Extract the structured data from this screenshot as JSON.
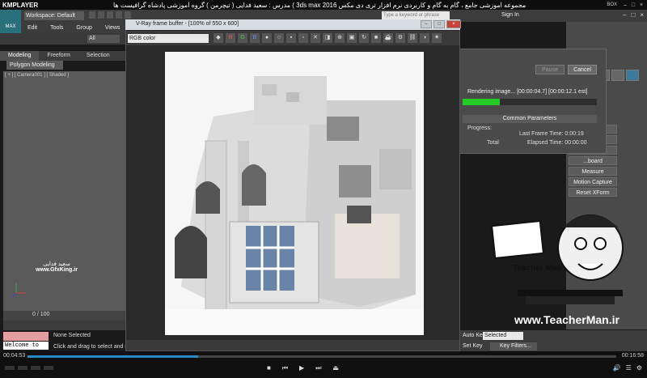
{
  "player": {
    "logo": "KMPLAYER",
    "title": "مجموعه آموزشی جامع ، گام به گام و کاربردی نرم افزار تری دی مکس 3ds max 2016 ) مدرس : سعید فدایی ( تیچرمن ) گروه آموزشی پادشاه گرافیست ها",
    "box_label": "BOX",
    "time_left": "00:04:53",
    "time_right": "00:16:58",
    "progress": 0.29
  },
  "max": {
    "logo": "MAX",
    "workspace": "Workspace: Default",
    "search_placeholder": "Type a keyword or phrase",
    "signin": "Sign In",
    "menus": [
      "Edit",
      "Tools",
      "Group",
      "Views"
    ],
    "selection_filter": "All",
    "ribbon_tabs": [
      "Modeling",
      "Freeform",
      "Selection"
    ],
    "ribbon_sub": "Polygon Modeling",
    "viewport_label": "[ + ] [ Camera001 ] [ Shaded ]",
    "frame_counter": "0 / 100",
    "welcome": "Welcome to M:",
    "status_selection": "None Selected",
    "status_hint": "Click and drag to select and mo",
    "auto_key": "Auto Key",
    "selected_dropdown": "Selected",
    "set_key": "Set Key",
    "key_filters": "Key Filters..."
  },
  "gfx_watermark": {
    "title": "سعید فدایی",
    "url": "www.GfxKing.ir"
  },
  "utilities": [
    "...wser",
    "...Match",
    "...e",
    "...board",
    "Measure",
    "Motion Capture",
    "Reset XForm"
  ],
  "render_dialog": {
    "pause": "Pause",
    "cancel": "Cancel",
    "rendering": "Rendering image... [00:00:04.7] [00:00:12.1 est]",
    "progress": 0.28,
    "common_params": "Common Parameters",
    "progress_label": "Progress:",
    "last_frame": "Last Frame Time:  0:00:19",
    "total": "Total",
    "elapsed": "Elapsed Time:  00:00:00"
  },
  "vfb": {
    "title": "V-Ray frame buffer - [100% of 550 x 600]",
    "channel": "RGB color",
    "channel_buttons": [
      "R",
      "G",
      "B"
    ]
  },
  "teacherman": {
    "name": "Teacher Man",
    "url": "www.TeacherMan.ir"
  },
  "colors": {
    "max_accent": "#2a6f7c",
    "progress_green": "#22cc22",
    "seek_blue": "#2a8ac4"
  }
}
